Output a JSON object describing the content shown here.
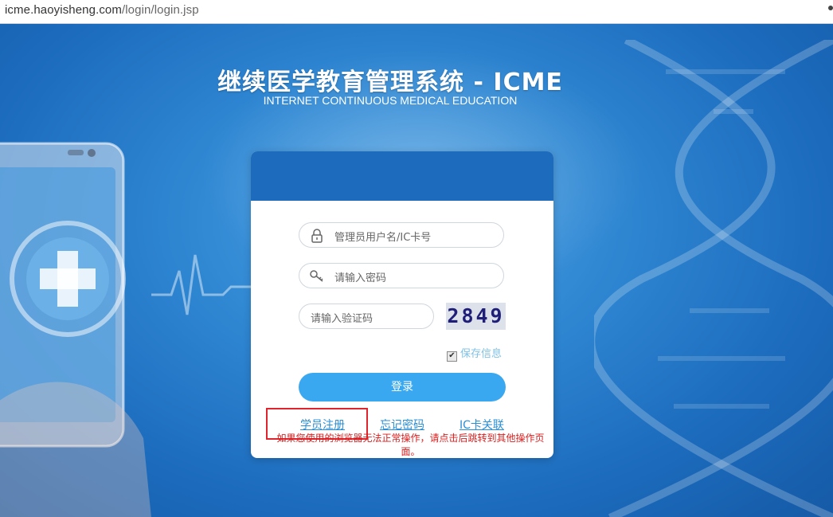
{
  "browser": {
    "url_host": "icme.haoyisheng.com",
    "url_path": "/login/login.jsp"
  },
  "header": {
    "title": "继续医学教育管理系统 - ICME",
    "subtitle": "INTERNET CONTINUOUS MEDICAL EDUCATION"
  },
  "login_form": {
    "username_placeholder": "管理员用户名/IC卡号",
    "password_placeholder": "请输入密码",
    "captcha_placeholder": "请输入验证码",
    "captcha_code": "2849",
    "remember_label": "保存信息",
    "remember_checked": true,
    "submit_label": "登录"
  },
  "links": {
    "register": "学员注册",
    "forgot_password": "忘记密码",
    "ic_card_link": "IC卡关联"
  },
  "notice": "如果您使用的浏览器无法正常操作，请点击后跳转到其他操作页面。",
  "icons": {
    "username": "lock-icon",
    "password": "key-icon",
    "menu": "more-dot-icon"
  },
  "colors": {
    "header_blue": "#1d6bbd",
    "button_blue": "#39a8f0",
    "link_blue": "#2a8fd6",
    "highlight_red": "#e0242d",
    "notice_red": "#d81e1e"
  }
}
